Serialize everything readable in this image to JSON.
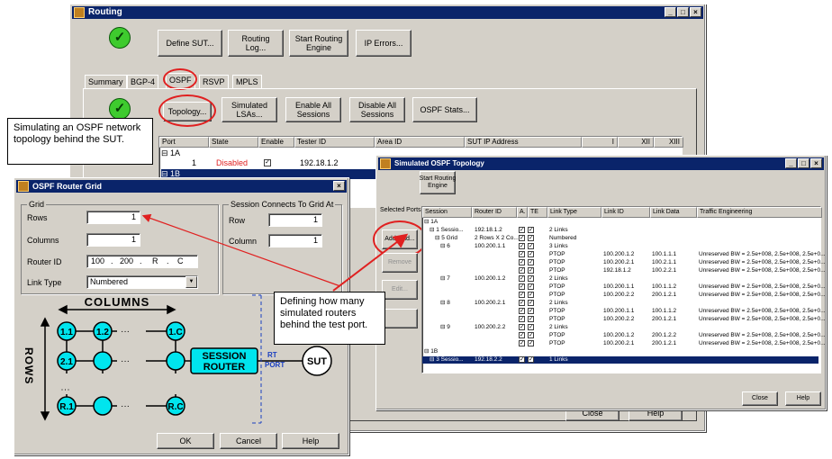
{
  "routing": {
    "title": "Routing",
    "buttons": {
      "define_sut": "Define SUT...",
      "routing_log": "Routing\nLog...",
      "start_engine": "Start Routing\nEngine",
      "ip_errors": "IP Errors..."
    },
    "tabs": [
      "Summary",
      "BGP-4",
      "OSPF",
      "RSVP",
      "MPLS"
    ],
    "ospf_buttons": {
      "topology": "Topology...",
      "simulated_lsas": "Simulated\nLSAs...",
      "enable_all": "Enable All\nSessions",
      "disable_all": "Disable All\nSessions",
      "ospf_stats": "OSPF Stats..."
    },
    "left_label": "orts",
    "columns": [
      "Port",
      "State",
      "Enable",
      "Tester ID",
      "Area ID",
      "SUT IP Address",
      "I",
      "XII",
      "XIII"
    ],
    "rows": [
      {
        "port": "1A"
      },
      {
        "port": "1",
        "state": "Disabled",
        "tester_id": "192.18.1.2"
      },
      {
        "port": "1B"
      }
    ],
    "close_partial": "Close",
    "help_partial": "Help"
  },
  "callout_1": "Simulating an OSPF network topology behind the SUT.",
  "callout_2": "Defining how many simulated routers behind the test port.",
  "grid_dialog": {
    "title": "OSPF Router Grid",
    "grid_group": "Grid",
    "rows_label": "Rows",
    "rows_value": "1",
    "columns_label": "Columns",
    "columns_value": "1",
    "router_id_label": "Router ID",
    "router_id": [
      "100",
      "200",
      "R",
      "C"
    ],
    "link_type_label": "Link Type",
    "link_type_value": "Numbered",
    "session_group": "Session Connects To Grid At",
    "row_label": "Row",
    "row_value": "1",
    "column_label": "Column",
    "column_value": "1",
    "diagram": {
      "columns": "COLUMNS",
      "rows": "ROWS",
      "n11": "1.1",
      "n12": "1.2",
      "n1c": "1.C",
      "n21": "2.1",
      "nr1": "R.1",
      "nrc": "R.C",
      "session_router": "SESSION\nROUTER",
      "rt_port": "RT\nPORT",
      "sut": "SUT"
    },
    "ok": "OK",
    "cancel": "Cancel",
    "help": "Help"
  },
  "topology_dialog": {
    "title": "Simulated OSPF Topology",
    "start_engine": "Start Routing\nEngine",
    "selected_ports": "Selected Ports",
    "add_grid": "Add Grid...",
    "remove": "Remove",
    "edit": "Edit...",
    "columns": [
      "Session",
      "Router ID",
      "A.",
      "TE",
      "Link Type",
      "Link ID",
      "Link Data",
      "Traffic Engineering"
    ],
    "rows": [
      {
        "session": "1A",
        "indent": 0
      },
      {
        "session": "1 Sessio...",
        "router": "192.18.1.2",
        "a": true,
        "te": true,
        "link_type": "2 Links",
        "indent": 1
      },
      {
        "session": "5 Grid",
        "router": "2 Rows X 2 Co...",
        "a": true,
        "te": true,
        "link_type": "Numbered",
        "indent": 2
      },
      {
        "session": "6",
        "router": "100.200.1.1",
        "a": true,
        "te": true,
        "link_type": "3 Links",
        "indent": 3
      },
      {
        "session": "",
        "router": "",
        "a": true,
        "te": true,
        "link_type": "PTOP",
        "link_id": "100.200.1.2",
        "link_data": "100.1.1.1",
        "traffic": "Unreserved BW = 2.5e+008, 2.5e+008, 2.5e+0...",
        "indent": 4
      },
      {
        "session": "",
        "router": "",
        "a": true,
        "te": true,
        "link_type": "PTOP",
        "link_id": "100.200.2.1",
        "link_data": "100.2.1.1",
        "traffic": "Unreserved BW = 2.5e+008, 2.5e+008, 2.5e+0...",
        "indent": 4
      },
      {
        "session": "",
        "router": "",
        "a": true,
        "te": true,
        "link_type": "PTOP",
        "link_id": "192.18.1.2",
        "link_data": "100.2.2.1",
        "traffic": "Unreserved BW = 2.5e+008, 2.5e+008, 2.5e+0...",
        "indent": 4
      },
      {
        "session": "7",
        "router": "100.200.1.2",
        "a": true,
        "te": true,
        "link_type": "2 Links",
        "indent": 3
      },
      {
        "session": "",
        "router": "",
        "a": true,
        "te": true,
        "link_type": "PTOP",
        "link_id": "100.200.1.1",
        "link_data": "100.1.1.2",
        "traffic": "Unreserved BW = 2.5e+008, 2.5e+008, 2.5e+0...",
        "indent": 4
      },
      {
        "session": "",
        "router": "",
        "a": true,
        "te": true,
        "link_type": "PTOP",
        "link_id": "100.200.2.2",
        "link_data": "200.1.2.1",
        "traffic": "Unreserved BW = 2.5e+008, 2.5e+008, 2.5e+0...",
        "indent": 4
      },
      {
        "session": "8",
        "router": "100.200.2.1",
        "a": true,
        "te": true,
        "link_type": "2 Links",
        "indent": 3
      },
      {
        "session": "",
        "router": "",
        "a": true,
        "te": true,
        "link_type": "PTOP",
        "link_id": "100.200.1.1",
        "link_data": "100.1.1.2",
        "traffic": "Unreserved BW = 2.5e+008, 2.5e+008, 2.5e+0...",
        "indent": 4
      },
      {
        "session": "",
        "router": "",
        "a": true,
        "te": true,
        "link_type": "PTOP",
        "link_id": "100.200.2.2",
        "link_data": "200.1.2.1",
        "traffic": "Unreserved BW = 2.5e+008, 2.5e+008, 2.5e+0...",
        "indent": 4
      },
      {
        "session": "9",
        "router": "100.200.2.2",
        "a": true,
        "te": true,
        "link_type": "2 Links",
        "indent": 3
      },
      {
        "session": "",
        "router": "",
        "a": true,
        "te": true,
        "link_type": "PTOP",
        "link_id": "100.200.1.2",
        "link_data": "200.1.2.2",
        "traffic": "Unreserved BW = 2.5e+008, 2.5e+008, 2.5e+0...",
        "indent": 4
      },
      {
        "session": "",
        "router": "",
        "a": true,
        "te": true,
        "link_type": "PTOP",
        "link_id": "100.200.2.1",
        "link_data": "200.1.2.1",
        "traffic": "Unreserved BW = 2.5e+008, 2.5e+008, 2.5e+0...",
        "indent": 4
      },
      {
        "session": "1B",
        "indent": 0
      },
      {
        "session": "3 Sessio...",
        "router": "192.18.2.2",
        "a": true,
        "te": true,
        "link_type": "1 Links",
        "indent": 1,
        "selected": true
      }
    ],
    "close": "Close",
    "help": "Help"
  },
  "colors": {
    "highlight": "#e02020",
    "titlebar": "#0a246a",
    "node": "#00e5ee",
    "check": "#3ecb2e"
  }
}
